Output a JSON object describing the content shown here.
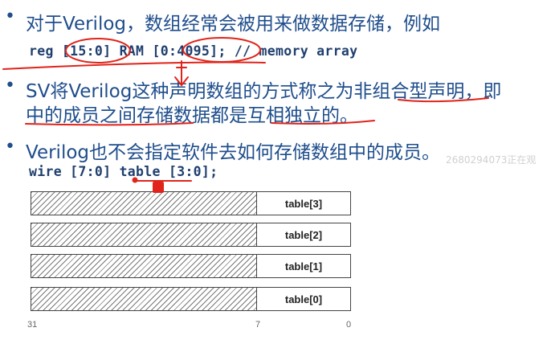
{
  "bullets": {
    "b1": {
      "marker": "•",
      "line1": "对于Verilog，数组经常会被用来做数据存储，例如",
      "code": "reg [15:0] RAM [0:4095]; // memory array"
    },
    "b2": {
      "marker": "•",
      "line1": "SV将Verilog这种声明数组的方式称之为非组合型声明，即",
      "line2": "中的成员之间存储数据都是互相独立的。"
    },
    "b3": {
      "marker": "•",
      "line1": "Verilog也不会指定软件去如何存储数组中的成员。",
      "code": "wire [7:0] table [3:0];"
    }
  },
  "diagram": {
    "rows": [
      {
        "label": "table[3]"
      },
      {
        "label": "table[2]"
      },
      {
        "label": "table[1]"
      },
      {
        "label": "table[0]"
      }
    ],
    "axis": {
      "left": "31",
      "mid": "7",
      "right": "0"
    }
  },
  "watermark": "2680294073正在观",
  "colors": {
    "text": "#1f4e8c",
    "annotation": "#e0241b"
  }
}
